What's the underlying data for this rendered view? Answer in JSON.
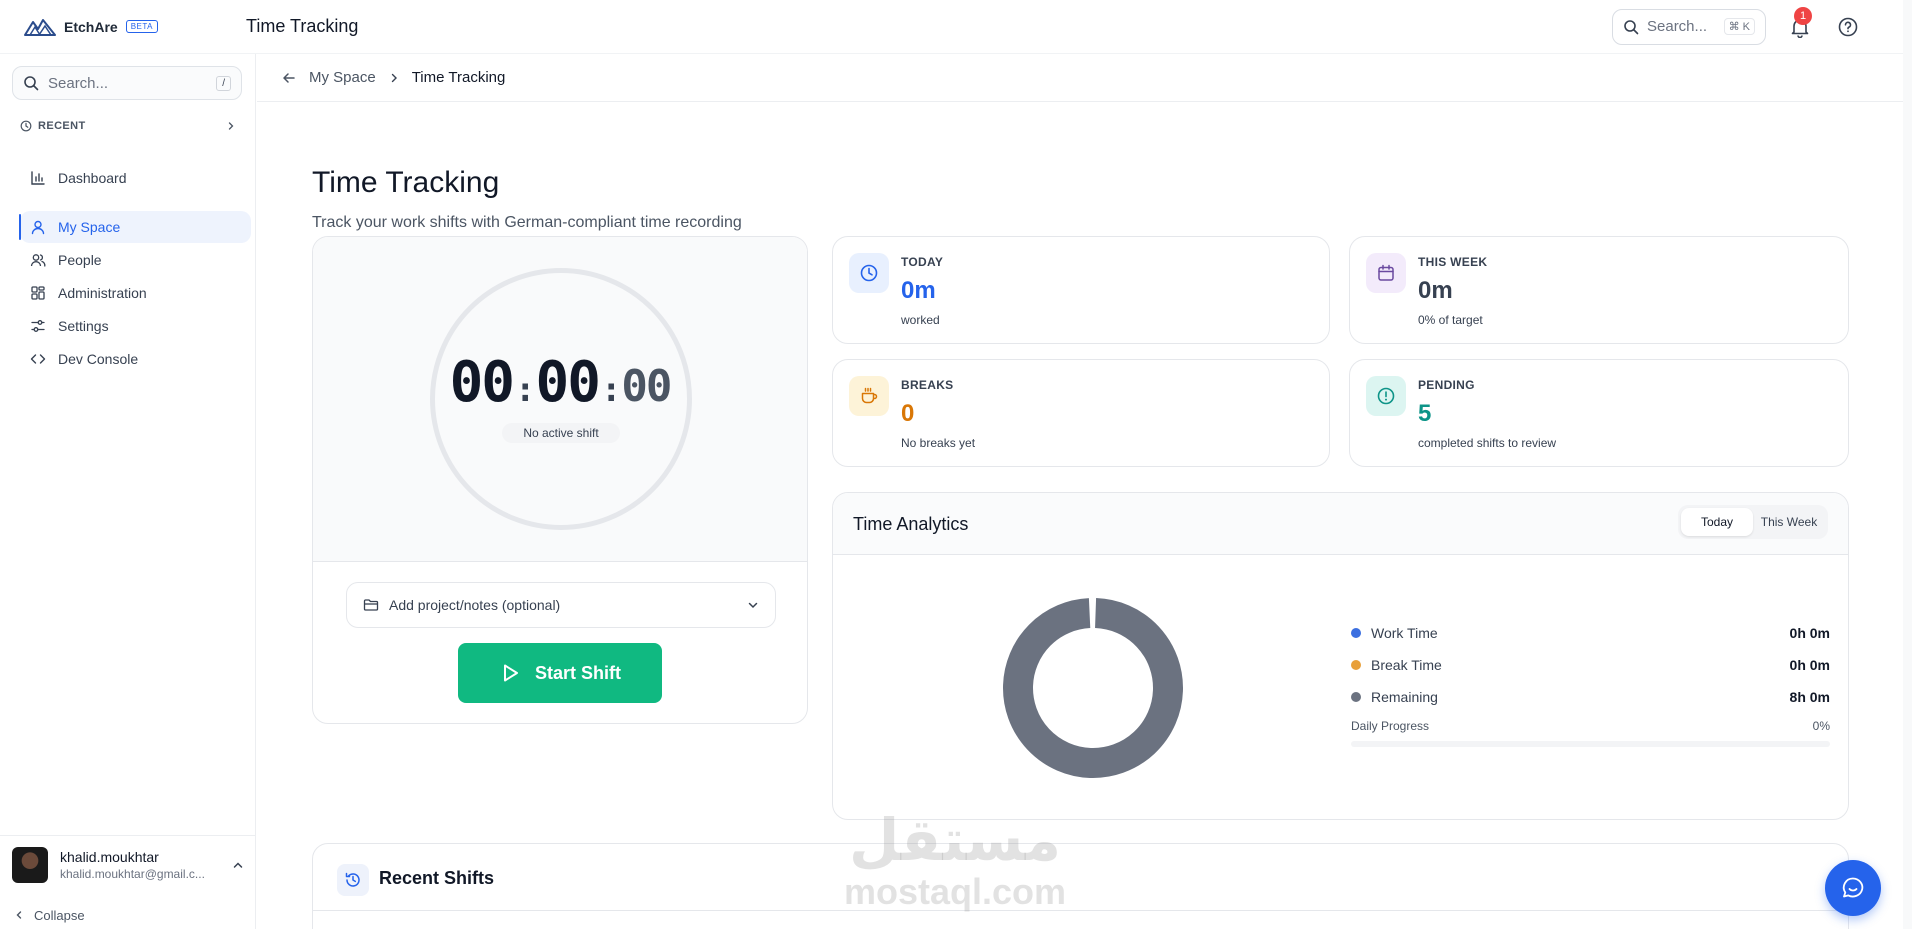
{
  "brand": {
    "name": "EtchAre",
    "badge": "BETA"
  },
  "topbar": {
    "title": "Time Tracking",
    "search_placeholder": "Search...",
    "search_shortcut": "⌘ K",
    "notification_count": "1"
  },
  "sidebar": {
    "search_placeholder": "Search...",
    "search_shortcut": "/",
    "recent_label": "RECENT",
    "items": [
      {
        "label": "Dashboard",
        "icon": "chart-bar-icon"
      },
      {
        "label": "My Space",
        "icon": "user-icon",
        "active": true
      },
      {
        "label": "People",
        "icon": "users-icon"
      },
      {
        "label": "Administration",
        "icon": "grid-icon"
      },
      {
        "label": "Settings",
        "icon": "sliders-icon"
      },
      {
        "label": "Dev Console",
        "icon": "code-icon"
      }
    ],
    "user": {
      "name": "khalid.moukhtar",
      "email": "khalid.moukhtar@gmail.c..."
    },
    "collapse_label": "Collapse"
  },
  "breadcrumb": {
    "parent": "My Space",
    "current": "Time Tracking"
  },
  "page": {
    "title": "Time Tracking",
    "subtitle": "Track your work shifts with German-compliant time recording"
  },
  "timer": {
    "hours": "00",
    "minutes": "00",
    "seconds": "00",
    "status": "No active shift",
    "project_placeholder": "Add project/notes (optional)",
    "start_label": "Start Shift"
  },
  "stats": {
    "today": {
      "label": "TODAY",
      "value": "0m",
      "sub": "worked",
      "color": "#2563eb"
    },
    "week": {
      "label": "THIS WEEK",
      "value": "0m",
      "sub": "0% of target",
      "color": "#374151"
    },
    "breaks": {
      "label": "BREAKS",
      "value": "0",
      "sub": "No breaks yet",
      "color": "#d97706"
    },
    "pending": {
      "label": "PENDING",
      "value": "5",
      "sub": "completed shifts to review",
      "color": "#0d9488"
    }
  },
  "analytics": {
    "title": "Time Analytics",
    "tabs": [
      {
        "label": "Today",
        "active": true
      },
      {
        "label": "This Week",
        "active": false
      }
    ],
    "legend": [
      {
        "label": "Work Time",
        "value": "0h 0m",
        "color": "#3b6fe0"
      },
      {
        "label": "Break Time",
        "value": "0h 0m",
        "color": "#e8a03a"
      },
      {
        "label": "Remaining",
        "value": "8h 0m",
        "color": "#6b7280"
      }
    ],
    "progress_label": "Daily Progress",
    "progress_value": "0%"
  },
  "recent_shifts": {
    "title": "Recent Shifts"
  },
  "watermark": {
    "arabic": "مستقل",
    "latin": "mostaql.com"
  }
}
